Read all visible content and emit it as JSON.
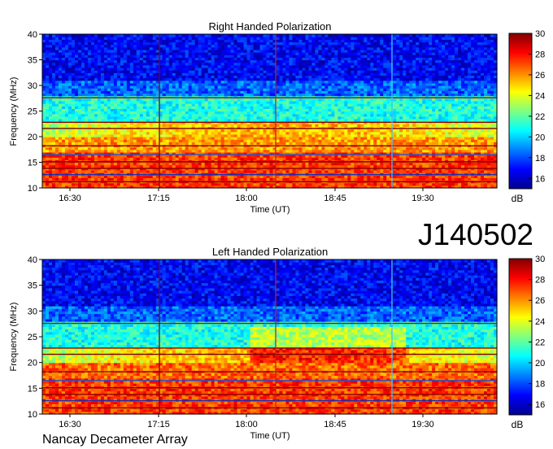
{
  "chart_data": [
    {
      "type": "heatmap",
      "title": "Right Handed Polarization",
      "xlabel": "Time (UT)",
      "ylabel": "Frequency (MHz)",
      "x_ticks": [
        "16:30",
        "17:15",
        "18:00",
        "18:45",
        "19:30"
      ],
      "y_ticks": [
        10,
        15,
        20,
        25,
        30,
        35,
        40
      ],
      "ylim": [
        10,
        40
      ],
      "colorbar": {
        "label": "dB",
        "ticks": [
          16,
          18,
          20,
          22,
          24,
          26,
          28,
          30
        ],
        "range": [
          15,
          30
        ]
      }
    },
    {
      "type": "heatmap",
      "title": "Left Handed Polarization",
      "xlabel": "Time (UT)",
      "ylabel": "Frequency (MHz)",
      "x_ticks": [
        "16:30",
        "17:15",
        "18:00",
        "18:45",
        "19:30"
      ],
      "y_ticks": [
        10,
        15,
        20,
        25,
        30,
        35,
        40
      ],
      "ylim": [
        10,
        40
      ],
      "colorbar": {
        "label": "dB",
        "ticks": [
          16,
          18,
          20,
          22,
          24,
          26,
          28,
          30
        ],
        "range": [
          15,
          30
        ]
      }
    }
  ],
  "observation_id": "J140502",
  "instrument": "Nancay Decameter Array"
}
